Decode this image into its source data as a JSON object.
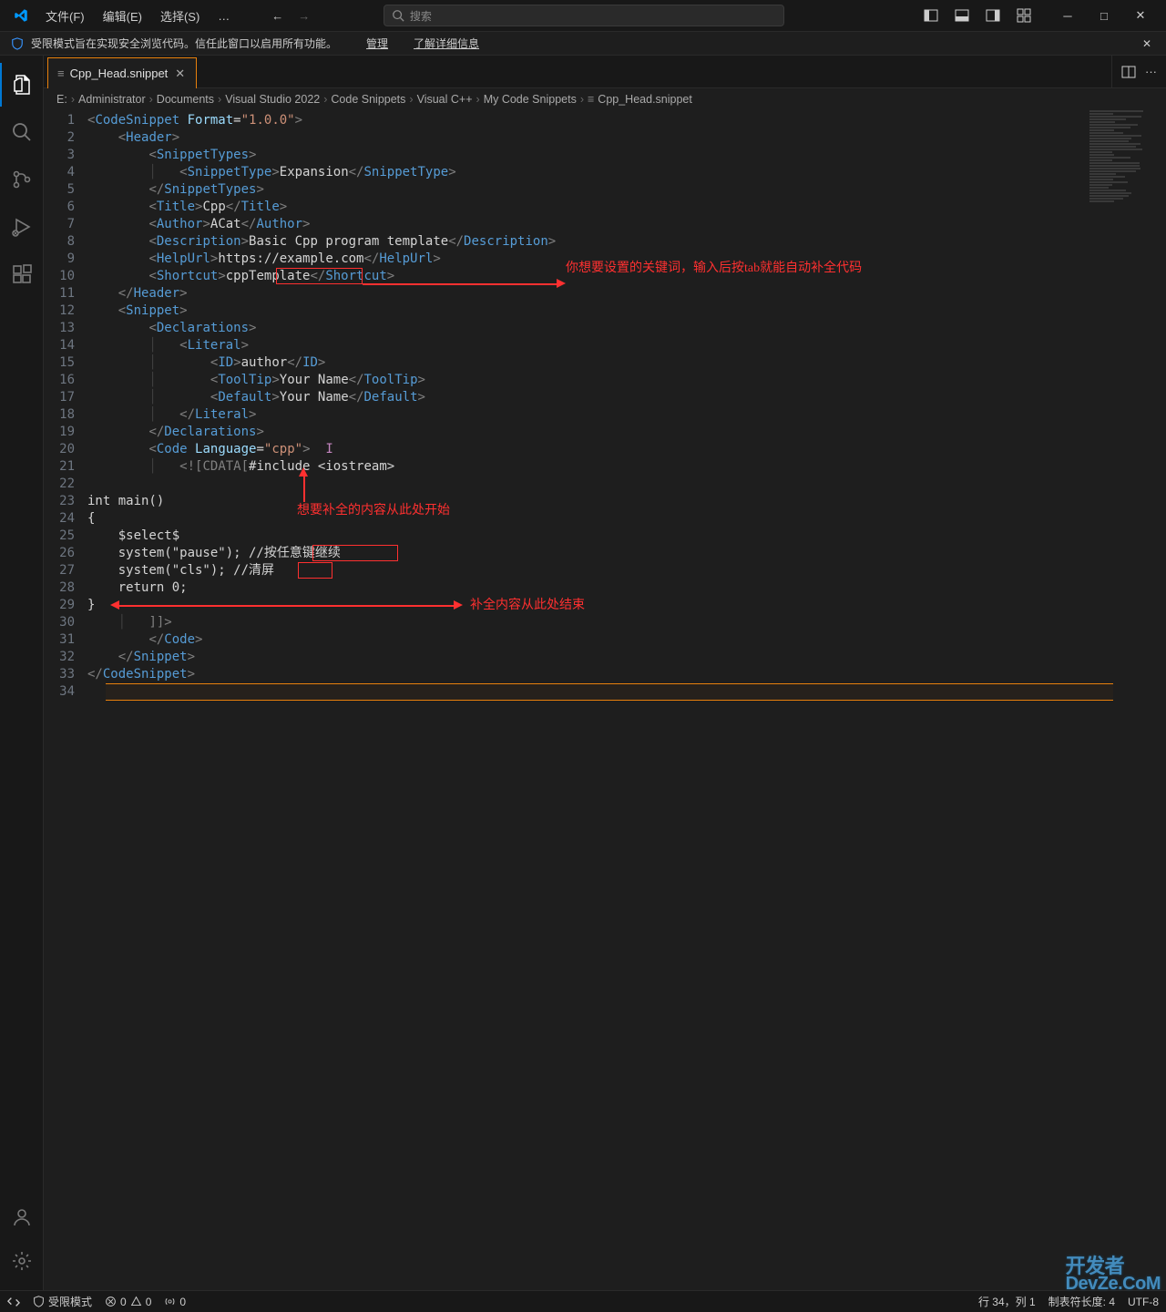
{
  "titlebar": {
    "menus": [
      "文件(F)",
      "编辑(E)",
      "选择(S)"
    ],
    "menu_dots": "…",
    "search_placeholder": "搜索"
  },
  "banner": {
    "text": "受限模式旨在实现安全浏览代码。信任此窗口以启用所有功能。",
    "manage": "管理",
    "learn_more": "了解详细信息"
  },
  "tab": {
    "label": "Cpp_Head.snippet"
  },
  "breadcrumbs": [
    "E:",
    "Administrator",
    "Documents",
    "Visual Studio 2022",
    "Code Snippets",
    "Visual C++",
    "My Code Snippets",
    "Cpp_Head.snippet"
  ],
  "code": {
    "lines": [
      {
        "n": 1,
        "html": "<span class='tag-bracket'>&lt;</span><span class='tag-name'>CodeSnippet</span> <span class='attr-name'>Format</span>=<span class='attr-value'>\"1.0.0\"</span><span class='tag-bracket'>&gt;</span>"
      },
      {
        "n": 2,
        "html": "    <span class='tag-bracket'>&lt;</span><span class='tag-name'>Header</span><span class='tag-bracket'>&gt;</span>"
      },
      {
        "n": 3,
        "html": "        <span class='tag-bracket'>&lt;</span><span class='tag-name'>SnippetTypes</span><span class='tag-bracket'>&gt;</span>"
      },
      {
        "n": 4,
        "html": "        <span class='guide'>│</span>   <span class='tag-bracket'>&lt;</span><span class='tag-name'>SnippetType</span><span class='tag-bracket'>&gt;</span>Expansion<span class='tag-bracket'>&lt;/</span><span class='tag-name'>SnippetType</span><span class='tag-bracket'>&gt;</span>"
      },
      {
        "n": 5,
        "html": "        <span class='tag-bracket'>&lt;/</span><span class='tag-name'>SnippetTypes</span><span class='tag-bracket'>&gt;</span>"
      },
      {
        "n": 6,
        "html": "        <span class='tag-bracket'>&lt;</span><span class='tag-name'>Title</span><span class='tag-bracket'>&gt;</span>Cpp<span class='tag-bracket'>&lt;/</span><span class='tag-name'>Title</span><span class='tag-bracket'>&gt;</span>"
      },
      {
        "n": 7,
        "html": "        <span class='tag-bracket'>&lt;</span><span class='tag-name'>Author</span><span class='tag-bracket'>&gt;</span>ACat<span class='tag-bracket'>&lt;/</span><span class='tag-name'>Author</span><span class='tag-bracket'>&gt;</span>"
      },
      {
        "n": 8,
        "html": "        <span class='tag-bracket'>&lt;</span><span class='tag-name'>Description</span><span class='tag-bracket'>&gt;</span>Basic Cpp program template<span class='tag-bracket'>&lt;/</span><span class='tag-name'>Description</span><span class='tag-bracket'>&gt;</span>"
      },
      {
        "n": 9,
        "html": "        <span class='tag-bracket'>&lt;</span><span class='tag-name'>HelpUrl</span><span class='tag-bracket'>&gt;</span>https://example.com<span class='tag-bracket'>&lt;/</span><span class='tag-name'>HelpUrl</span><span class='tag-bracket'>&gt;</span>"
      },
      {
        "n": 10,
        "html": "        <span class='tag-bracket'>&lt;</span><span class='tag-name'>Shortcut</span><span class='tag-bracket'>&gt;</span>cppTemplate<span class='tag-bracket'>&lt;/</span><span class='tag-name'>Shortcut</span><span class='tag-bracket'>&gt;</span>"
      },
      {
        "n": 11,
        "html": "    <span class='tag-bracket'>&lt;/</span><span class='tag-name'>Header</span><span class='tag-bracket'>&gt;</span>"
      },
      {
        "n": 12,
        "html": "    <span class='tag-bracket'>&lt;</span><span class='tag-name'>Snippet</span><span class='tag-bracket'>&gt;</span>"
      },
      {
        "n": 13,
        "html": "        <span class='tag-bracket'>&lt;</span><span class='tag-name'>Declarations</span><span class='tag-bracket'>&gt;</span>"
      },
      {
        "n": 14,
        "html": "        <span class='guide'>│</span>   <span class='tag-bracket'>&lt;</span><span class='tag-name'>Literal</span><span class='tag-bracket'>&gt;</span>"
      },
      {
        "n": 15,
        "html": "        <span class='guide'>│</span>       <span class='tag-bracket'>&lt;</span><span class='tag-name'>ID</span><span class='tag-bracket'>&gt;</span>author<span class='tag-bracket'>&lt;/</span><span class='tag-name'>ID</span><span class='tag-bracket'>&gt;</span>"
      },
      {
        "n": 16,
        "html": "        <span class='guide'>│</span>       <span class='tag-bracket'>&lt;</span><span class='tag-name'>ToolTip</span><span class='tag-bracket'>&gt;</span>Your Name<span class='tag-bracket'>&lt;/</span><span class='tag-name'>ToolTip</span><span class='tag-bracket'>&gt;</span>"
      },
      {
        "n": 17,
        "html": "        <span class='guide'>│</span>       <span class='tag-bracket'>&lt;</span><span class='tag-name'>Default</span><span class='tag-bracket'>&gt;</span>Your Name<span class='tag-bracket'>&lt;/</span><span class='tag-name'>Default</span><span class='tag-bracket'>&gt;</span>"
      },
      {
        "n": 18,
        "html": "        <span class='guide'>│</span>   <span class='tag-bracket'>&lt;/</span><span class='tag-name'>Literal</span><span class='tag-bracket'>&gt;</span>"
      },
      {
        "n": 19,
        "html": "        <span class='tag-bracket'>&lt;/</span><span class='tag-name'>Declarations</span><span class='tag-bracket'>&gt;</span>"
      },
      {
        "n": 20,
        "html": "        <span class='tag-bracket'>&lt;</span><span class='tag-name'>Code</span> <span class='attr-name'>Language</span>=<span class='attr-value'>\"cpp\"</span><span class='tag-bracket'>&gt;</span>  <span style='color:#c586c0'>I</span>"
      },
      {
        "n": 21,
        "html": "        <span class='guide'>│</span>   <span class='cdata'>&lt;![CDATA[</span>#include &lt;iostream&gt;"
      },
      {
        "n": 22,
        "html": ""
      },
      {
        "n": 23,
        "html": "int main()"
      },
      {
        "n": 24,
        "html": "{"
      },
      {
        "n": 25,
        "html": "    $select$"
      },
      {
        "n": 26,
        "html": "    system(\"pause\"); //按任意键继续"
      },
      {
        "n": 27,
        "html": "    system(\"cls\"); //清屏"
      },
      {
        "n": 28,
        "html": "    return 0;"
      },
      {
        "n": 29,
        "html": "}"
      },
      {
        "n": 30,
        "html": "    <span class='guide'>│</span>   <span class='cdata'>]]&gt;</span>"
      },
      {
        "n": 31,
        "html": "        <span class='tag-bracket'>&lt;/</span><span class='tag-name'>Code</span><span class='tag-bracket'>&gt;</span>"
      },
      {
        "n": 32,
        "html": "    <span class='tag-bracket'>&lt;/</span><span class='tag-name'>Snippet</span><span class='tag-bracket'>&gt;</span>"
      },
      {
        "n": 33,
        "html": "<span class='tag-bracket'>&lt;/</span><span class='tag-name'>CodeSnippet</span><span class='tag-bracket'>&gt;</span>"
      },
      {
        "n": 34,
        "html": ""
      }
    ]
  },
  "annotations": {
    "anno1": "你想要设置的关键词，输入后按tab就能自动补全代码",
    "anno2": "想要补全的内容从此处开始",
    "anno3": "补全内容从此处结束",
    "comment26": "按任意键继续",
    "comment27": "清屏"
  },
  "statusbar": {
    "restricted": "受限模式",
    "errors": "0",
    "warnings": "0",
    "port": "0",
    "cursor": "行 34，列 1",
    "tabsize": "制表符长度: 4",
    "encoding": "UTF-8"
  },
  "watermark": {
    "line1": "开发者",
    "line2": "DevZe.CoM"
  }
}
